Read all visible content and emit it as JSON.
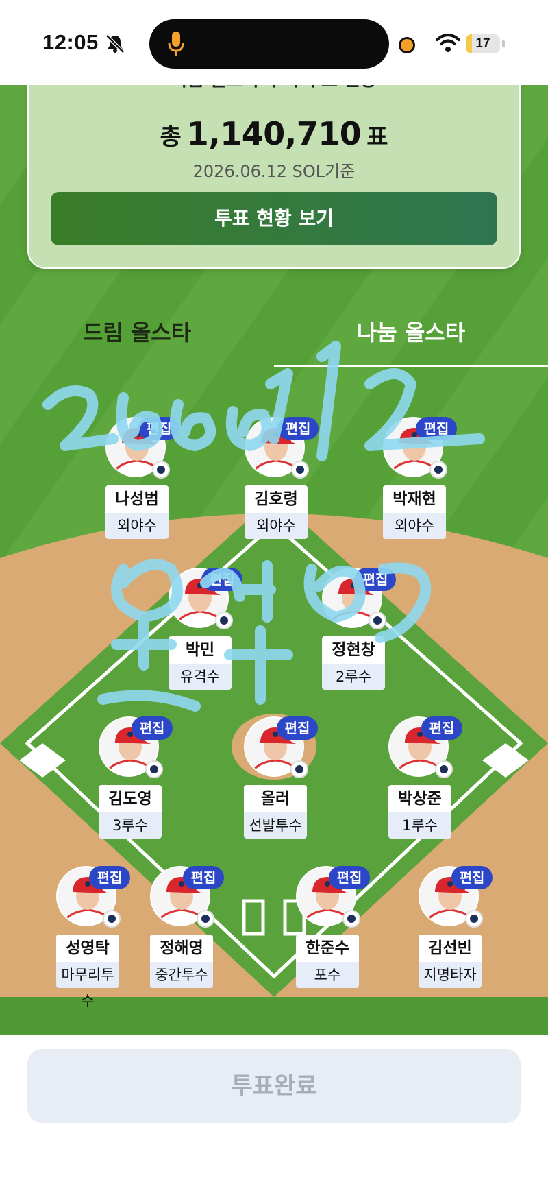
{
  "status_bar": {
    "time": "12:05",
    "battery": "17",
    "battery_level": 0.17
  },
  "summary": {
    "partial_heading": "나눔 올스타 누적 투표 현황",
    "total_prefix": "총",
    "total_votes": "1,140,710",
    "total_suffix": "표",
    "date_basis": "2026.06.12 SOL기준",
    "status_button_label": "투표 현황 보기"
  },
  "tabs": [
    {
      "label": "드림 올스타",
      "active": false
    },
    {
      "label": "나눔 올스타",
      "active": true
    }
  ],
  "edit_label": "편집",
  "players": [
    {
      "name": "나성범",
      "position": "외야수"
    },
    {
      "name": "김호령",
      "position": "외야수"
    },
    {
      "name": "박재현",
      "position": "외야수"
    },
    {
      "name": "박민",
      "position": "유격수"
    },
    {
      "name": "정현창",
      "position": "2루수"
    },
    {
      "name": "김도영",
      "position": "3루수"
    },
    {
      "name": "올러",
      "position": "선발투수"
    },
    {
      "name": "박상준",
      "position": "1루수"
    },
    {
      "name": "성영탁",
      "position": "마무리투수"
    },
    {
      "name": "정해영",
      "position": "중간투수"
    },
    {
      "name": "한준수",
      "position": "포수"
    },
    {
      "name": "김선빈",
      "position": "지명타자"
    }
  ],
  "vote_complete_label": "투표완료",
  "colors": {
    "field_green": "#5aa33c",
    "infield_dirt": "#d7a874",
    "edit_badge": "#2c46c8",
    "status_button": "#3a7d28",
    "scribble": "#8fd8f0"
  }
}
